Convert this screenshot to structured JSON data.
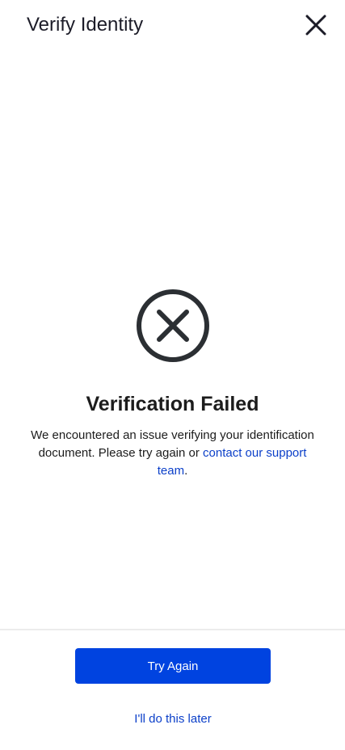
{
  "header": {
    "title": "Verify Identity",
    "close_icon": "close-icon"
  },
  "status": {
    "icon": "error-x-circle-icon",
    "title": "Verification Failed",
    "message_prefix": "We encountered an issue verifying your identification document. Please try again or ",
    "support_link": "contact our support team",
    "message_suffix": "."
  },
  "actions": {
    "primary_label": "Try Again",
    "secondary_label": "I'll do this later"
  },
  "colors": {
    "accent": "#0043e0",
    "link": "#0b3fc9",
    "icon_stroke": "#2b2f33"
  }
}
